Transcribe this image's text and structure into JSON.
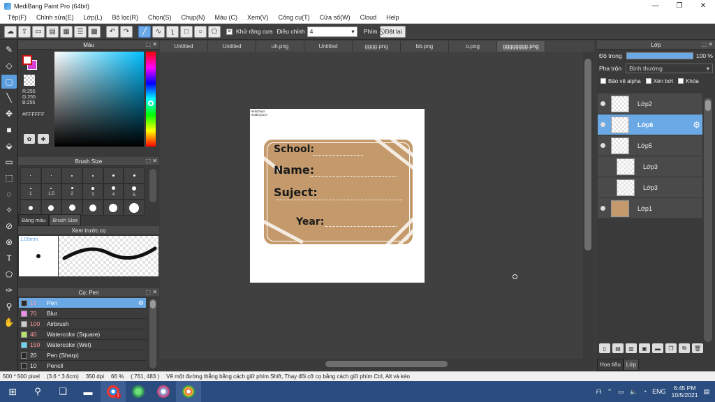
{
  "window": {
    "title": "MediBang Paint Pro (64bit)",
    "min": "—",
    "max": "❐",
    "close": "✕"
  },
  "menu": [
    "Tệp(F)",
    "Chỉnh sửa(E)",
    "Lớp(L)",
    "Bộ lọc(R)",
    "Chọn(S)",
    "Chụp(N)",
    "Màu (C)",
    "Xem(V)",
    "Công cụ(T)",
    "Cửa số(W)",
    "Cloud",
    "Help"
  ],
  "toolbar": {
    "antialias_label": "Khử răng cưa",
    "adjust_label": "Điều chỉnh",
    "adjust_value": "4",
    "key_label": "Phím",
    "reset_label": "Đặt lại"
  },
  "color_panel": {
    "title": "Màu",
    "r": "R:255",
    "g": "G:255",
    "b": "B:255",
    "hex": "#FFFFFF"
  },
  "brush_size": {
    "title": "Brush Size",
    "sizes": [
      "1",
      "1.5",
      "2",
      "3",
      "4",
      "5"
    ],
    "tab_palette": "Bảng màu",
    "tab_size": "Brush Size"
  },
  "preview": {
    "title": "Xem trước cọ",
    "size": "1.09mm"
  },
  "brush_list": {
    "title": "Cọ: Pen",
    "items": [
      {
        "num": "15",
        "name": "Pen",
        "color": "#2a2a2a",
        "active": true
      },
      {
        "num": "70",
        "name": "Blur",
        "color": "#f08ef0"
      },
      {
        "num": "100",
        "name": "Airbrush",
        "color": "#cccccc"
      },
      {
        "num": "40",
        "name": "Watercolor (Square)",
        "color": "#b6e36a"
      },
      {
        "num": "150",
        "name": "Watercolor (Wet)",
        "color": "#6cd6f0"
      },
      {
        "num": "20",
        "name": "Pen (Sharp)",
        "color": "#2a2a2a"
      },
      {
        "num": "10",
        "name": "Pencil",
        "color": "#2a2a2a"
      }
    ]
  },
  "tabs": [
    "Untitled",
    "Untitled",
    "uh.png",
    "Untitled",
    "gggg.png",
    "bb.png",
    "o.png",
    "gggggggg.png"
  ],
  "canvas": {
    "watermark_1": "HelloDays",
    "watermark_2": "Hiddicijo247",
    "school": "School:",
    "name": "Name:",
    "subject": "Suject:",
    "year": "Year:",
    "card_color": "#c49a6c"
  },
  "layers_panel": {
    "title": "Lớp",
    "opacity_label": "Độ trong",
    "opacity_value": "100 %",
    "opacity": 1.0,
    "blend_label": "Pha trộn",
    "blend_value": "Bình thường",
    "protect_alpha": "Bảo vệ alpha",
    "clipping": "Xén bớt",
    "lock": "Khóa",
    "layers": [
      {
        "name": "Lớp2",
        "visible": true
      },
      {
        "name": "Lớp6",
        "visible": true,
        "active": true
      },
      {
        "name": "Lớp5",
        "visible": true
      },
      {
        "name": "Lớp3",
        "visible": false,
        "indent": true
      },
      {
        "name": "Lớp3",
        "visible": false,
        "indent": true
      },
      {
        "name": "Lớp1",
        "visible": true,
        "brown": true
      }
    ],
    "tab_materials": "Hoa tiêu",
    "tab_layer": "Lớp"
  },
  "status": {
    "size": "500 * 500 pixel",
    "cm": "(3.6 * 3.6cm)",
    "dpi": "350 dpi",
    "zoom": "66 %",
    "coords": "( 761, 483 )",
    "hint": "Vẽ một đường thẳng bằng cách giữ phím Shift, Thay đổi cỡ cọ bằng cách giữ phím Ctrl, Alt và kéo"
  },
  "taskbar": {
    "lang": "ENG",
    "time": "6:45 PM",
    "date": "10/5/2021",
    "badge": "1"
  },
  "accent_color": "#6aa9e6"
}
